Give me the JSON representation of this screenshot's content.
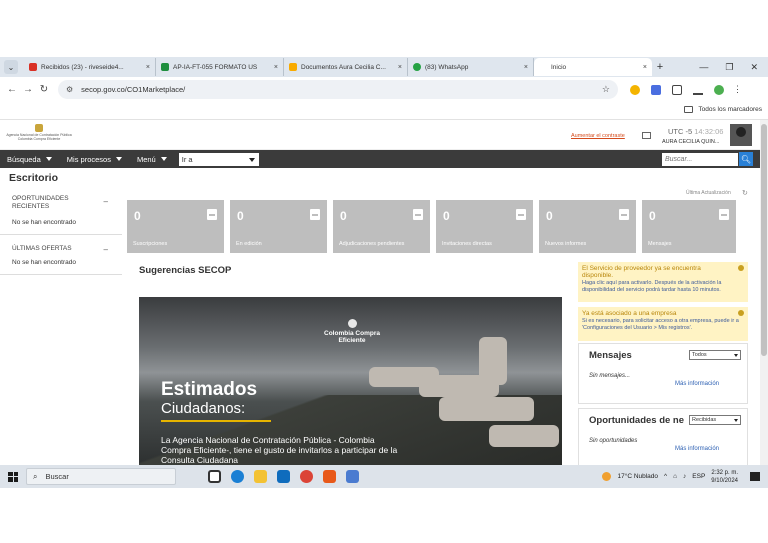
{
  "browser": {
    "tabs": [
      {
        "title": "Recibidos (23) - riveseide4...",
        "color": "#d93025"
      },
      {
        "title": "AP-IA-FT-055 FORMATO US",
        "color": "#1e8e3e"
      },
      {
        "title": "Documentos Aura Cecilia C...",
        "color": "#f9ab00"
      },
      {
        "title": "(83) WhatsApp",
        "color": "#25a244"
      },
      {
        "title": "Inicio",
        "color": "#ffffff"
      }
    ],
    "tab_close": "×",
    "new_tab": "+",
    "url": "secop.gov.co/CO1Marketplace/",
    "bookmarks_all": "Todos los marcadores"
  },
  "header": {
    "logo_text": "Agencia Nacional de Contratación Pública Colombia Compra Eficiente",
    "support_link": "Aumentar el contraste",
    "time_zone": "UTC -5",
    "time": "14:32:06",
    "user_name": "AURA CECILIA QUIN..."
  },
  "navbar": {
    "busqueda": "Búsqueda",
    "mis_procesos": "Mis procesos",
    "menu": "Menú",
    "ira_value": "Ir a",
    "search_placeholder": "Buscar...",
    "search_icon": "search-icon"
  },
  "page": {
    "title": "Escritorio",
    "last_update": "Última Actualización"
  },
  "sidebar": {
    "sections": [
      {
        "title": "OPORTUNIDADES RECIENTES",
        "value": "No se han encontrado"
      },
      {
        "title": "ÚLTIMAS OFERTAS",
        "value": "No se han encontrado"
      }
    ],
    "collapse": "–"
  },
  "tiles": [
    {
      "count": "0",
      "label": "Suscripciones"
    },
    {
      "count": "0",
      "label": "En edición"
    },
    {
      "count": "0",
      "label": "Adjudicaciones pendientes"
    },
    {
      "count": "0",
      "label": "Invitaciones directas"
    },
    {
      "count": "0",
      "label": "Nuevos informes"
    },
    {
      "count": "0",
      "label": "Mensajes"
    }
  ],
  "suggestions": {
    "title": "Sugerencias SECOP",
    "banner": {
      "brand": "Colombia Compra Eficiente",
      "headline": "Estimados",
      "subheadline": "Ciudadanos:",
      "text": "La Agencia Nacional de Contratación Pública - Colombia Compra Eficiente-, tiene el gusto de invitarlos a participar de la Consulta Ciudadana"
    }
  },
  "notices": [
    {
      "head": "El Servicio de proveedor ya se encuentra disponible.",
      "body": "Haga clic aquí para activarlo. Después de la activación la disponibilidad del servicio podrá tardar hasta 10 minutos."
    },
    {
      "head": "Ya está asociado a una empresa",
      "body": "Si es necesario, para solicitar acceso a otra empresa, puede ir a 'Configuraciones del Usuario > Mis registros'."
    }
  ],
  "widgets": {
    "mensajes": {
      "title": "Mensajes",
      "filter": "Todos",
      "empty": "Sin mensajes...",
      "more": "Más información"
    },
    "oportunidades": {
      "title": "Oportunidades de ne",
      "filter": "Recibidas",
      "empty": "Sin oportunidades",
      "more": "Más información"
    }
  },
  "taskbar": {
    "search": "Buscar",
    "weather": "17°C  Nublado",
    "lang": "ESP",
    "time": "2:32 p. m.",
    "date": "9/10/2024"
  }
}
